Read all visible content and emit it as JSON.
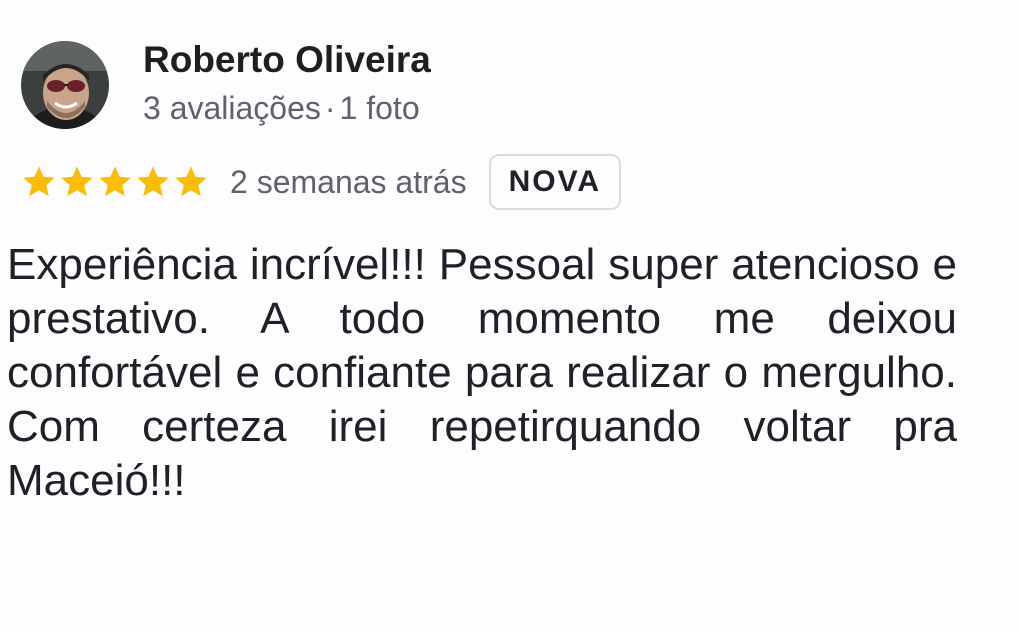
{
  "reviewer": {
    "name": "Roberto Oliveira",
    "reviews_count": "3 avaliações",
    "separator": "·",
    "photos_count": "1 foto",
    "avatar_icon": "user-avatar-photo"
  },
  "rating": {
    "stars": 5,
    "star_color": "#fbbc04",
    "star_icon": "star-icon",
    "time_ago": "2 semanas atrás",
    "badge": "NOVA"
  },
  "review": {
    "text": "Experiência incrível!!! Pessoal super atencioso e prestativo. A todo momento me deixou confortável e confiante para realizar o mergulho. Com certeza irei  repetirquando voltar pra Maceió!!!"
  }
}
